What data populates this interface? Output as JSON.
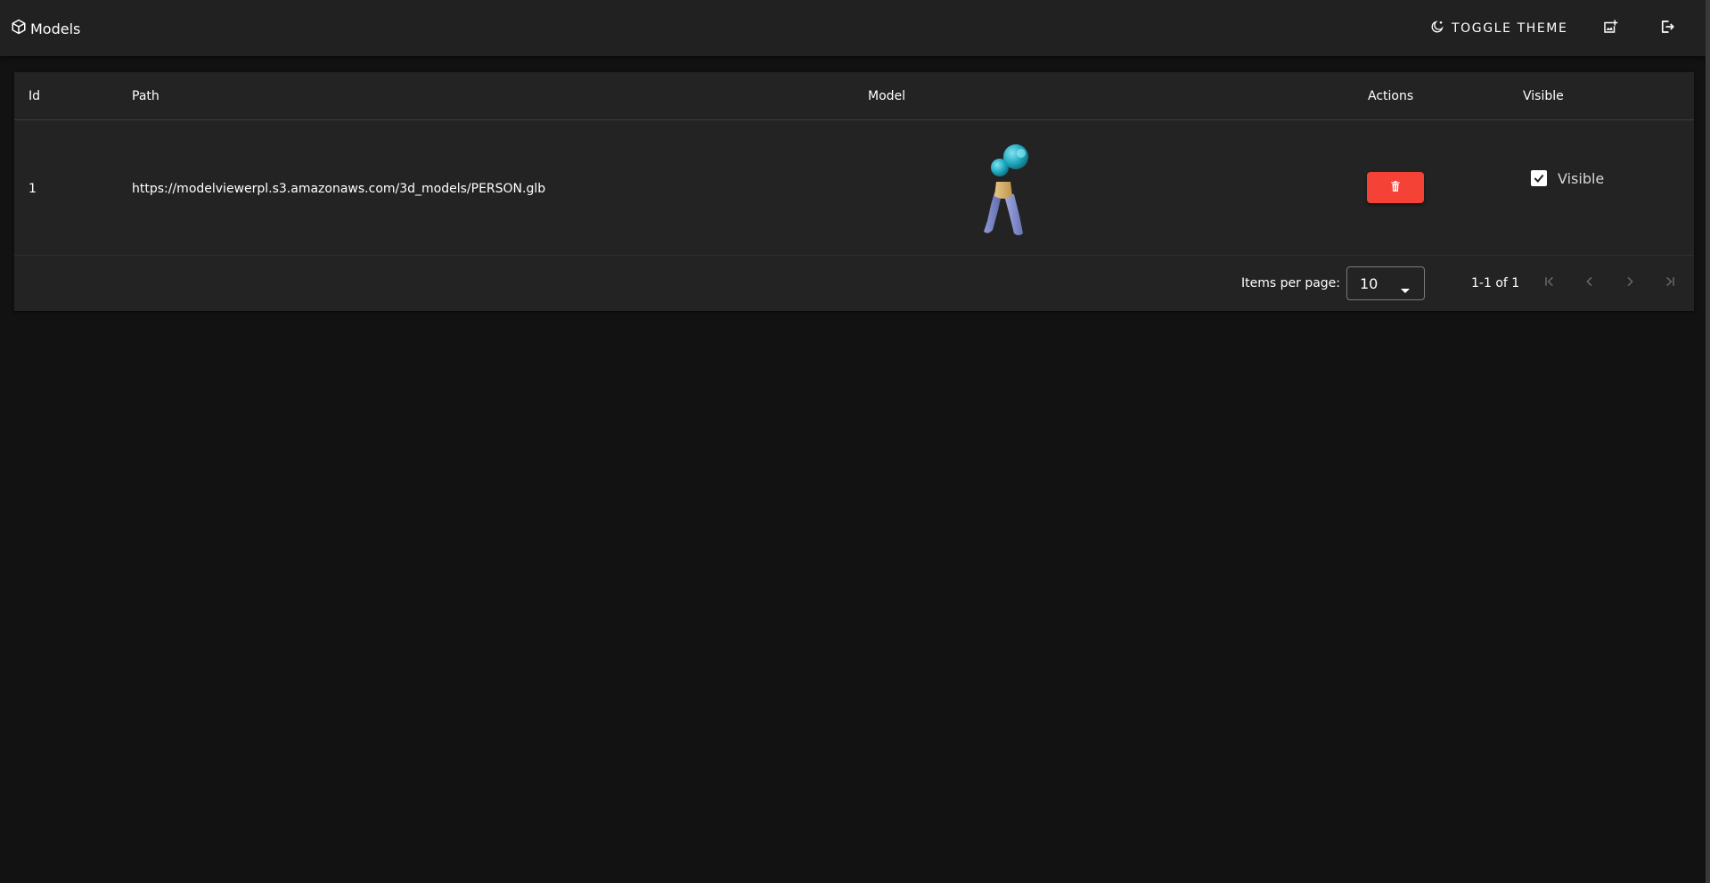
{
  "app": {
    "title": "Models",
    "toggle_theme_label": "TOGGLE THEME"
  },
  "table": {
    "columns": [
      "Id",
      "Path",
      "Model",
      "Actions",
      "Visible"
    ],
    "rows": [
      {
        "id": "1",
        "path": "https://modelviewerpl.s3.amazonaws.com/3d_models/PERSON.glb",
        "visible_label": "Visible",
        "visible_checked": true
      }
    ]
  },
  "pagination": {
    "items_per_page_label": "Items per page:",
    "items_per_page_value": "10",
    "range_label": "1-1 of 1"
  },
  "colors": {
    "page_background": "#121212",
    "surface": "#232323",
    "appbar": "#212121",
    "delete_button": "#f44336"
  },
  "icons": {
    "brand": "cube-icon",
    "theme": "moon-icon",
    "add_model": "add-photo-icon",
    "logout": "logout-icon",
    "delete": "trash-icon"
  }
}
